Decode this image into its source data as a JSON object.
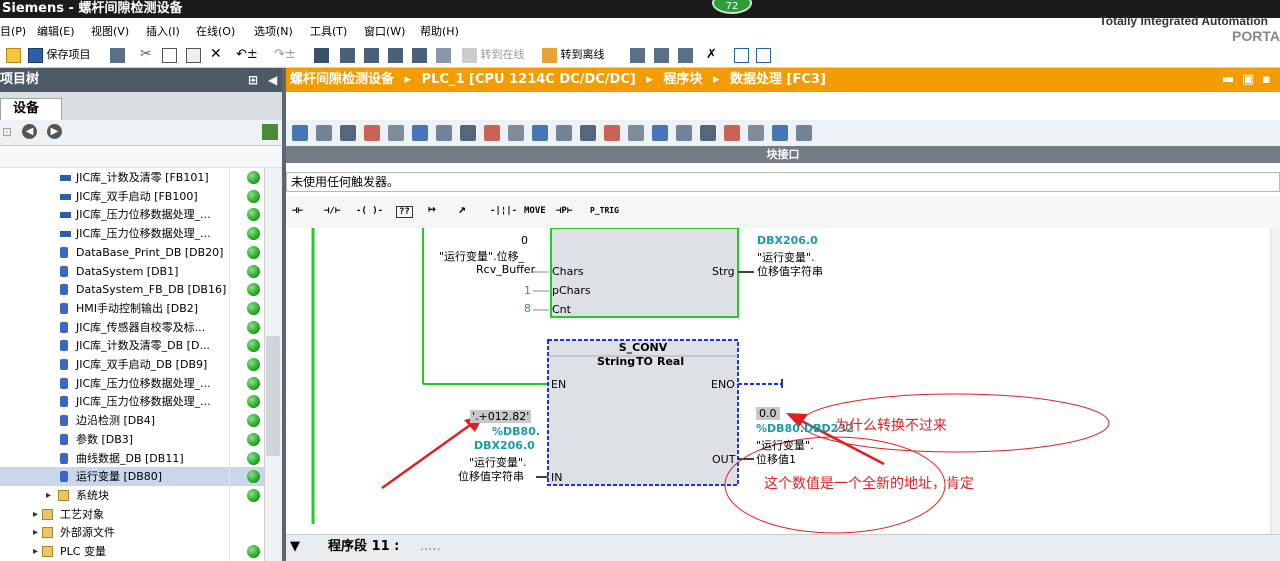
{
  "window": {
    "title": "Siemens  -  螺杆间隙检测设备",
    "badge": "72"
  },
  "menu": {
    "items": [
      "目(P)",
      "编辑(E)",
      "视图(V)",
      "插入(I)",
      "在线(O)",
      "选项(N)",
      "工具(T)",
      "窗口(W)",
      "帮助(H)"
    ]
  },
  "brand": {
    "line1": "Totally Integrated Automation",
    "line2": "PORTA"
  },
  "toolbar": {
    "save_project": "保存项目",
    "go_online": "转到在线",
    "go_offline": "转到离线"
  },
  "project_tree": {
    "header": "项目树",
    "tab": "设备",
    "items": [
      {
        "label": "JIC库_计数及清零 [FB101]",
        "type": "fb",
        "status": "ok"
      },
      {
        "label": "JIC库_双手启动 [FB100]",
        "type": "fb",
        "status": "ok"
      },
      {
        "label": "JIC库_压力位移数据处理_...",
        "type": "fb",
        "status": "ok"
      },
      {
        "label": "JIC库_压力位移数据处理_...",
        "type": "fb",
        "status": "ok"
      },
      {
        "label": "DataBase_Print_DB [DB20]",
        "type": "db",
        "status": "ok"
      },
      {
        "label": "DataSystem [DB1]",
        "type": "db",
        "status": "ok"
      },
      {
        "label": "DataSystem_FB_DB [DB16]",
        "type": "db",
        "status": "ok"
      },
      {
        "label": "HMI手动控制输出 [DB2]",
        "type": "db",
        "status": "ok"
      },
      {
        "label": "JIC库_传感器自校零及标...",
        "type": "db",
        "status": "ok"
      },
      {
        "label": "JIC库_计数及清零_DB [D...",
        "type": "db",
        "status": "ok"
      },
      {
        "label": "JIC库_双手启动_DB [DB9]",
        "type": "db",
        "status": "ok"
      },
      {
        "label": "JIC库_压力位移数据处理_...",
        "type": "db",
        "status": "ok"
      },
      {
        "label": "JIC库_压力位移数据处理_...",
        "type": "db",
        "status": "ok"
      },
      {
        "label": "边沿检测 [DB4]",
        "type": "db",
        "status": "ok"
      },
      {
        "label": "参数 [DB3]",
        "type": "db",
        "status": "ok"
      },
      {
        "label": "曲线数据_DB [DB11]",
        "type": "db",
        "status": "ok"
      },
      {
        "label": "运行变量 [DB80]",
        "type": "db",
        "status": "ok",
        "selected": true
      },
      {
        "label": "系统块",
        "type": "folder",
        "status": "ok"
      },
      {
        "label": "工艺对象",
        "type": "folder",
        "status": ""
      },
      {
        "label": "外部源文件",
        "type": "folder",
        "status": ""
      },
      {
        "label": "PLC 变量",
        "type": "folder",
        "status": "ok"
      }
    ]
  },
  "breadcrumb": [
    "螺杆间隙检测设备",
    "PLC_1 [CPU 1214C DC/DC/DC]",
    "程序块",
    "数据处理 [FC3]"
  ],
  "editor": {
    "block_interface": "块接口",
    "trigger_text": "未使用任何触发器。",
    "ladder_elements": [
      "⊣⊢",
      "⊣/⊢",
      "-( )-",
      "??",
      "↦",
      "↗",
      "-|¦|-",
      "MOVE",
      "⊣P⊢",
      "P_TRIG"
    ],
    "upper_block": {
      "in_value_0": "0",
      "chars_var1": "\"运行变量\".位移_",
      "chars_var2": "Rcv_Buffer",
      "pin_chars": "Chars",
      "pin_pchars": "pChars",
      "pin_cnt": "Cnt",
      "pchars_value": "1",
      "cnt_value": "8",
      "pin_strg": "Strg",
      "strg_addr": "DBX206.0",
      "strg_var1": "\"运行变量\".",
      "strg_var2": "位移值字符串"
    },
    "sconv": {
      "title": "S_CONV",
      "types": [
        "String",
        "TO",
        "Real"
      ],
      "pin_en": "EN",
      "pin_eno": "ENO",
      "pin_in": "IN",
      "pin_out": "OUT",
      "in_value": "'.+012.82'",
      "in_addr1": "%DB80.",
      "in_addr2": "DBX206.0",
      "in_var1": "\"运行变量\".",
      "in_var2": "位移值字符串",
      "out_value": "0.0",
      "out_addr": "%DB80.DBD232",
      "out_var1": "\"运行变量\".",
      "out_var2": "位移值1"
    },
    "annotations": {
      "note1": "为什么转换不过来",
      "note2": "这个数值是一个全新的地址，肯定"
    },
    "segment": {
      "label": "程序段 11 :",
      "comment": "....."
    }
  },
  "colors": {
    "accent": "#f39c00",
    "wire": "#22cc22",
    "annotation": "#e02020",
    "teal": "#1a9aa8"
  }
}
